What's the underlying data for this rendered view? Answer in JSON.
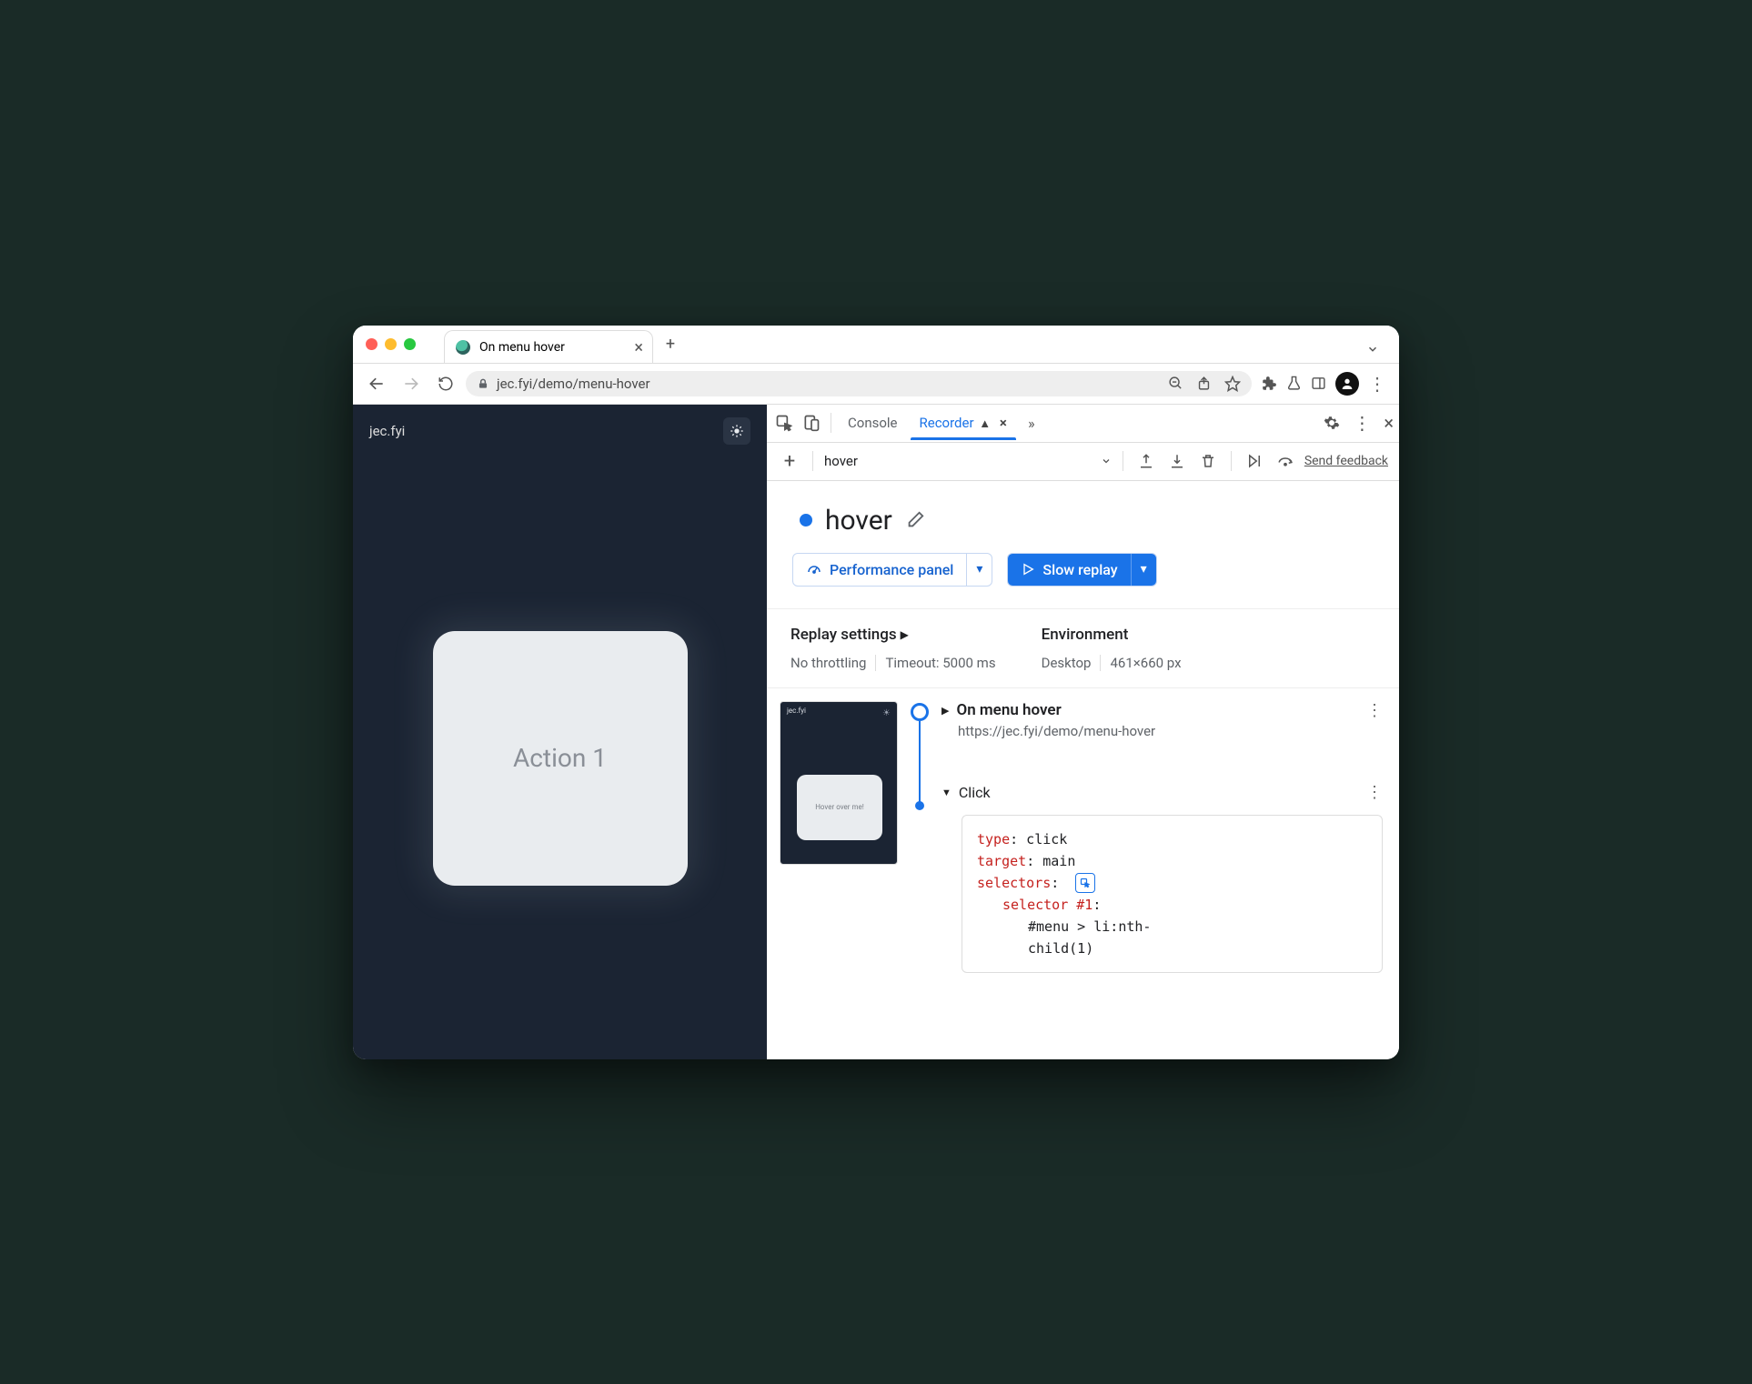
{
  "browser": {
    "tab_title": "On menu hover",
    "url_display": "jec.fyi/demo/menu-hover"
  },
  "site": {
    "brand": "jec.fyi",
    "card_text": "Action 1"
  },
  "devtools": {
    "tabs": {
      "console": "Console",
      "recorder": "Recorder"
    },
    "recording_name_small": "hover",
    "send_feedback": "Send feedback",
    "title": "hover",
    "perf_btn": "Performance panel",
    "replay_btn": "Slow replay",
    "settings": {
      "heading": "Replay settings",
      "throttling": "No throttling",
      "timeout": "Timeout: 5000 ms",
      "env_heading": "Environment",
      "env_device": "Desktop",
      "env_size": "461×660 px"
    },
    "thumb": {
      "brand": "jec.fyi",
      "card": "Hover over me!"
    },
    "steps": {
      "first_title": "On menu hover",
      "first_url": "https://jec.fyi/demo/menu-hover",
      "click": "Click",
      "code": {
        "l1k": "type",
        "l1v": ": click",
        "l2k": "target",
        "l2v": ": main",
        "l3k": "selectors",
        "l3v": ":",
        "l4k": "selector #1",
        "l4v": ":",
        "l5": "#menu > li:nth-",
        "l6": "child(1)"
      }
    }
  }
}
